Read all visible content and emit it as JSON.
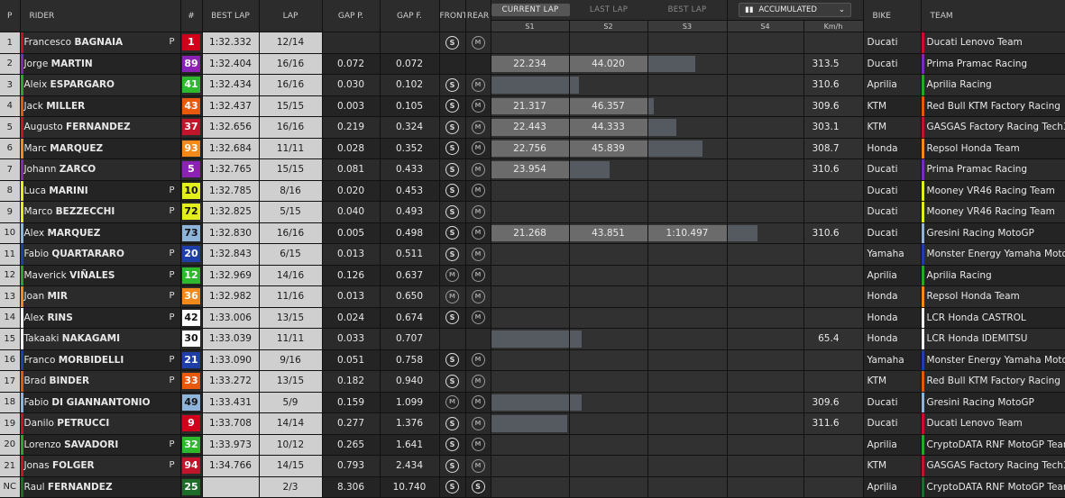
{
  "header": {
    "pos": "P",
    "rider": "RIDER",
    "num": "#",
    "best_lap": "BEST LAP",
    "lap": "LAP",
    "gap_p": "GAP P.",
    "gap_f": "GAP F.",
    "front": "FRONT",
    "rear": "REAR",
    "tabs": [
      "CURRENT LAP",
      "LAST LAP",
      "BEST LAP"
    ],
    "active_tab": "CURRENT LAP",
    "accumulated": "ACCUMULATED",
    "sectors": [
      "S1",
      "S2",
      "S3",
      "S4",
      "Km/h"
    ],
    "bike": "BIKE",
    "team": "TEAM"
  },
  "tyre_labels": {
    "soft": "S",
    "medium": "M"
  },
  "rows": [
    {
      "pos": "1",
      "first": "Francesco",
      "last": "BAGNAIA",
      "pit": "P",
      "num": "1",
      "num_bg": "#d0021b",
      "num_fg": "#ffffff",
      "best": "1:32.332",
      "lap": "12/14",
      "gap_p": "",
      "gap_f": "",
      "front": "S",
      "rear": "M",
      "s1": "",
      "s2": "",
      "s3": "",
      "s1f": 0,
      "s2f": 0,
      "s3f": 0,
      "kmh": "",
      "bike": "Ducati",
      "team": "Ducati Lenovo Team",
      "color": "#c8102e"
    },
    {
      "pos": "2",
      "first": "Jorge",
      "last": "MARTIN",
      "pit": "",
      "num": "89",
      "num_bg": "#8c22b3",
      "num_fg": "#ffffff",
      "best": "1:32.404",
      "lap": "16/16",
      "gap_p": "0.072",
      "gap_f": "0.072",
      "front": "",
      "rear": "",
      "s1": "22.234",
      "s2": "44.020",
      "s3": "",
      "s1f": 1,
      "s2f": 1,
      "s3f": 0.6,
      "kmh": "313.5",
      "bike": "Ducati",
      "team": "Prima Pramac Racing",
      "color": "#7b2bb5"
    },
    {
      "pos": "3",
      "first": "Aleix",
      "last": "ESPARGARO",
      "pit": "",
      "num": "41",
      "num_bg": "#2db82d",
      "num_fg": "#ffffff",
      "best": "1:32.434",
      "lap": "16/16",
      "gap_p": "0.030",
      "gap_f": "0.102",
      "front": "S",
      "rear": "M",
      "s1": "",
      "s2": "",
      "s3": "",
      "s1f": 1,
      "s2f": 0.12,
      "s3f": 0,
      "kmh": "310.6",
      "bike": "Aprilia",
      "team": "Aprilia Racing",
      "color": "#2aa52a"
    },
    {
      "pos": "4",
      "first": "Jack",
      "last": "MILLER",
      "pit": "",
      "num": "43",
      "num_bg": "#e8590c",
      "num_fg": "#ffffff",
      "best": "1:32.437",
      "lap": "15/15",
      "gap_p": "0.003",
      "gap_f": "0.105",
      "front": "S",
      "rear": "M",
      "s1": "21.317",
      "s2": "46.357",
      "s3": "",
      "s1f": 1,
      "s2f": 1,
      "s3f": 0.07,
      "kmh": "309.6",
      "bike": "KTM",
      "team": "Red Bull KTM Factory Racing",
      "color": "#e05a0c"
    },
    {
      "pos": "5",
      "first": "Augusto",
      "last": "FERNANDEZ",
      "pit": "",
      "num": "37",
      "num_bg": "#c0152a",
      "num_fg": "#ffffff",
      "best": "1:32.656",
      "lap": "16/16",
      "gap_p": "0.219",
      "gap_f": "0.324",
      "front": "S",
      "rear": "M",
      "s1": "22.443",
      "s2": "44.333",
      "s3": "",
      "s1f": 1,
      "s2f": 1,
      "s3f": 0.36,
      "kmh": "303.1",
      "bike": "KTM",
      "team": "GASGAS Factory Racing Tech3",
      "color": "#c0152a"
    },
    {
      "pos": "6",
      "first": "Marc",
      "last": "MARQUEZ",
      "pit": "",
      "num": "93",
      "num_bg": "#f28a1b",
      "num_fg": "#ffffff",
      "best": "1:32.684",
      "lap": "11/11",
      "gap_p": "0.028",
      "gap_f": "0.352",
      "front": "S",
      "rear": "M",
      "s1": "22.756",
      "s2": "45.839",
      "s3": "",
      "s1f": 1,
      "s2f": 1,
      "s3f": 0.7,
      "kmh": "308.7",
      "bike": "Honda",
      "team": "Repsol Honda Team",
      "color": "#f28a1b"
    },
    {
      "pos": "7",
      "first": "Johann",
      "last": "ZARCO",
      "pit": "",
      "num": "5",
      "num_bg": "#8c22b3",
      "num_fg": "#ffffff",
      "best": "1:32.765",
      "lap": "15/15",
      "gap_p": "0.081",
      "gap_f": "0.433",
      "front": "S",
      "rear": "M",
      "s1": "23.954",
      "s2": "",
      "s3": "",
      "s1f": 1,
      "s2f": 0.52,
      "s3f": 0,
      "kmh": "310.6",
      "bike": "Ducati",
      "team": "Prima Pramac Racing",
      "color": "#7b2bb5"
    },
    {
      "pos": "8",
      "first": "Luca",
      "last": "MARINI",
      "pit": "P",
      "num": "10",
      "num_bg": "#e2ef1a",
      "num_fg": "#111111",
      "best": "1:32.785",
      "lap": "8/16",
      "gap_p": "0.020",
      "gap_f": "0.453",
      "front": "S",
      "rear": "M",
      "s1": "",
      "s2": "",
      "s3": "",
      "s1f": 0,
      "s2f": 0,
      "s3f": 0,
      "kmh": "",
      "bike": "Ducati",
      "team": "Mooney VR46 Racing Team",
      "color": "#e2ef1a"
    },
    {
      "pos": "9",
      "first": "Marco",
      "last": "BEZZECCHI",
      "pit": "P",
      "num": "72",
      "num_bg": "#e2ef1a",
      "num_fg": "#111111",
      "best": "1:32.825",
      "lap": "5/15",
      "gap_p": "0.040",
      "gap_f": "0.493",
      "front": "S",
      "rear": "M",
      "s1": "",
      "s2": "",
      "s3": "",
      "s1f": 0,
      "s2f": 0,
      "s3f": 0,
      "kmh": "",
      "bike": "Ducati",
      "team": "Mooney VR46 Racing Team",
      "color": "#e2ef1a"
    },
    {
      "pos": "10",
      "first": "Alex",
      "last": "MARQUEZ",
      "pit": "",
      "num": "73",
      "num_bg": "#8fb4d9",
      "num_fg": "#111111",
      "best": "1:32.830",
      "lap": "16/16",
      "gap_p": "0.005",
      "gap_f": "0.498",
      "front": "S",
      "rear": "M",
      "s1": "21.268",
      "s2": "43.851",
      "s3": "1:10.497",
      "s1f": 1,
      "s2f": 1,
      "s3f": 1,
      "s4f": 0.4,
      "kmh": "310.6",
      "bike": "Ducati",
      "team": "Gresini Racing MotoGP",
      "color": "#8fb4d9"
    },
    {
      "pos": "11",
      "first": "Fabio",
      "last": "QUARTARARO",
      "pit": "P",
      "num": "20",
      "num_bg": "#1f3fa8",
      "num_fg": "#ffffff",
      "best": "1:32.843",
      "lap": "6/15",
      "gap_p": "0.013",
      "gap_f": "0.511",
      "front": "S",
      "rear": "M",
      "s1": "",
      "s2": "",
      "s3": "",
      "s1f": 0,
      "s2f": 0,
      "s3f": 0,
      "kmh": "",
      "bike": "Yamaha",
      "team": "Monster Energy Yamaha MotoGP",
      "color": "#1f3fa8"
    },
    {
      "pos": "12",
      "first": "Maverick",
      "last": "VIÑALES",
      "pit": "P",
      "num": "12",
      "num_bg": "#2db82d",
      "num_fg": "#ffffff",
      "best": "1:32.969",
      "lap": "14/16",
      "gap_p": "0.126",
      "gap_f": "0.637",
      "front": "M",
      "rear": "M",
      "s1": "",
      "s2": "",
      "s3": "",
      "s1f": 0,
      "s2f": 0,
      "s3f": 0,
      "kmh": "",
      "bike": "Aprilia",
      "team": "Aprilia Racing",
      "color": "#2aa52a"
    },
    {
      "pos": "13",
      "first": "Joan",
      "last": "MIR",
      "pit": "P",
      "num": "36",
      "num_bg": "#f28a1b",
      "num_fg": "#ffffff",
      "best": "1:32.982",
      "lap": "11/16",
      "gap_p": "0.013",
      "gap_f": "0.650",
      "front": "M",
      "rear": "M",
      "s1": "",
      "s2": "",
      "s3": "",
      "s1f": 0,
      "s2f": 0,
      "s3f": 0,
      "kmh": "",
      "bike": "Honda",
      "team": "Repsol Honda Team",
      "color": "#f28a1b"
    },
    {
      "pos": "14",
      "first": "Alex",
      "last": "RINS",
      "pit": "P",
      "num": "42",
      "num_bg": "#ffffff",
      "num_fg": "#111111",
      "best": "1:33.006",
      "lap": "13/15",
      "gap_p": "0.024",
      "gap_f": "0.674",
      "front": "S",
      "rear": "M",
      "s1": "",
      "s2": "",
      "s3": "",
      "s1f": 0,
      "s2f": 0,
      "s3f": 0,
      "kmh": "",
      "bike": "Honda",
      "team": "LCR Honda CASTROL",
      "color": "#ffffff"
    },
    {
      "pos": "15",
      "first": "Takaaki",
      "last": "NAKAGAMI",
      "pit": "",
      "num": "30",
      "num_bg": "#ffffff",
      "num_fg": "#111111",
      "best": "1:33.039",
      "lap": "11/11",
      "gap_p": "0.033",
      "gap_f": "0.707",
      "front": "",
      "rear": "",
      "s1": "",
      "s2": "",
      "s3": "",
      "s1f": 1,
      "s2f": 0.16,
      "s3f": 0,
      "kmh": "65.4",
      "bike": "Honda",
      "team": "LCR Honda IDEMITSU",
      "color": "#ffffff"
    },
    {
      "pos": "16",
      "first": "Franco",
      "last": "MORBIDELLI",
      "pit": "P",
      "num": "21",
      "num_bg": "#1f3fa8",
      "num_fg": "#ffffff",
      "best": "1:33.090",
      "lap": "9/16",
      "gap_p": "0.051",
      "gap_f": "0.758",
      "front": "S",
      "rear": "M",
      "s1": "",
      "s2": "",
      "s3": "",
      "s1f": 0,
      "s2f": 0,
      "s3f": 0,
      "kmh": "",
      "bike": "Yamaha",
      "team": "Monster Energy Yamaha MotoGP",
      "color": "#1f3fa8"
    },
    {
      "pos": "17",
      "first": "Brad",
      "last": "BINDER",
      "pit": "P",
      "num": "33",
      "num_bg": "#e8590c",
      "num_fg": "#ffffff",
      "best": "1:33.272",
      "lap": "13/15",
      "gap_p": "0.182",
      "gap_f": "0.940",
      "front": "S",
      "rear": "M",
      "s1": "",
      "s2": "",
      "s3": "",
      "s1f": 0,
      "s2f": 0,
      "s3f": 0,
      "kmh": "",
      "bike": "KTM",
      "team": "Red Bull KTM Factory Racing",
      "color": "#e05a0c"
    },
    {
      "pos": "18",
      "first": "Fabio",
      "last": "DI GIANNANTONIO",
      "pit": "",
      "num": "49",
      "num_bg": "#8fb4d9",
      "num_fg": "#111111",
      "best": "1:33.431",
      "lap": "5/9",
      "gap_p": "0.159",
      "gap_f": "1.099",
      "front": "M",
      "rear": "M",
      "s1": "",
      "s2": "",
      "s3": "",
      "s1f": 1,
      "s2f": 0.16,
      "s3f": 0,
      "kmh": "309.6",
      "bike": "Ducati",
      "team": "Gresini Racing MotoGP",
      "color": "#8fb4d9"
    },
    {
      "pos": "19",
      "first": "Danilo",
      "last": "PETRUCCI",
      "pit": "",
      "num": "9",
      "num_bg": "#d0021b",
      "num_fg": "#ffffff",
      "best": "1:33.708",
      "lap": "14/14",
      "gap_p": "0.277",
      "gap_f": "1.376",
      "front": "S",
      "rear": "M",
      "s1": "",
      "s2": "",
      "s3": "",
      "s1f": 0.98,
      "s2f": 0,
      "s3f": 0,
      "kmh": "311.6",
      "bike": "Ducati",
      "team": "Ducati Lenovo Team",
      "color": "#c8102e"
    },
    {
      "pos": "20",
      "first": "Lorenzo",
      "last": "SAVADORI",
      "pit": "P",
      "num": "32",
      "num_bg": "#2db82d",
      "num_fg": "#ffffff",
      "best": "1:33.973",
      "lap": "10/12",
      "gap_p": "0.265",
      "gap_f": "1.641",
      "front": "S",
      "rear": "M",
      "s1": "",
      "s2": "",
      "s3": "",
      "s1f": 0,
      "s2f": 0,
      "s3f": 0,
      "kmh": "",
      "bike": "Aprilia",
      "team": "CryptoDATA RNF MotoGP Team",
      "color": "#2aa52a"
    },
    {
      "pos": "21",
      "first": "Jonas",
      "last": "FOLGER",
      "pit": "P",
      "num": "94",
      "num_bg": "#c0152a",
      "num_fg": "#ffffff",
      "best": "1:34.766",
      "lap": "14/15",
      "gap_p": "0.793",
      "gap_f": "2.434",
      "front": "S",
      "rear": "M",
      "s1": "",
      "s2": "",
      "s3": "",
      "s1f": 0,
      "s2f": 0,
      "s3f": 0,
      "kmh": "",
      "bike": "KTM",
      "team": "GASGAS Factory Racing Tech3",
      "color": "#c0152a"
    },
    {
      "pos": "NC",
      "first": "Raul",
      "last": "FERNANDEZ",
      "pit": "",
      "num": "25",
      "num_bg": "#1e6b2a",
      "num_fg": "#ffffff",
      "best": "",
      "lap": "2/3",
      "gap_p": "8.306",
      "gap_f": "10.740",
      "front": "S",
      "rear": "S",
      "s1": "",
      "s2": "",
      "s3": "",
      "s1f": 0,
      "s2f": 0,
      "s3f": 0,
      "kmh": "",
      "bike": "Aprilia",
      "team": "CryptoDATA RNF MotoGP Team",
      "color": "#1e6b2a"
    }
  ]
}
